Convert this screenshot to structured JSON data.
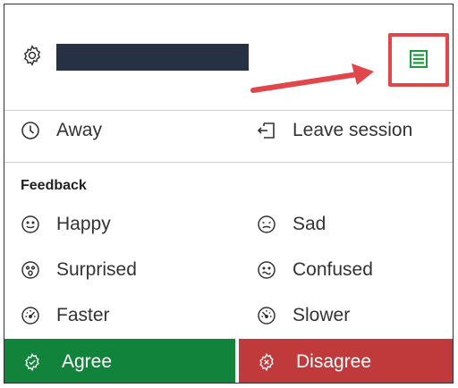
{
  "header": {
    "settings_icon": "gear-icon",
    "menu_icon": "list-menu-icon",
    "highlight_color": "#e0464a"
  },
  "status": {
    "away_label": "Away",
    "leave_label": "Leave session"
  },
  "feedback": {
    "section_title": "Feedback",
    "items": [
      {
        "label": "Happy",
        "icon": "happy-face-icon"
      },
      {
        "label": "Sad",
        "icon": "sad-face-icon"
      },
      {
        "label": "Surprised",
        "icon": "surprised-face-icon"
      },
      {
        "label": "Confused",
        "icon": "confused-face-icon"
      },
      {
        "label": "Faster",
        "icon": "faster-gauge-icon"
      },
      {
        "label": "Slower",
        "icon": "slower-gauge-icon"
      }
    ]
  },
  "vote": {
    "agree_label": "Agree",
    "disagree_label": "Disagree",
    "agree_color": "#12833a",
    "disagree_color": "#c03a3b"
  }
}
